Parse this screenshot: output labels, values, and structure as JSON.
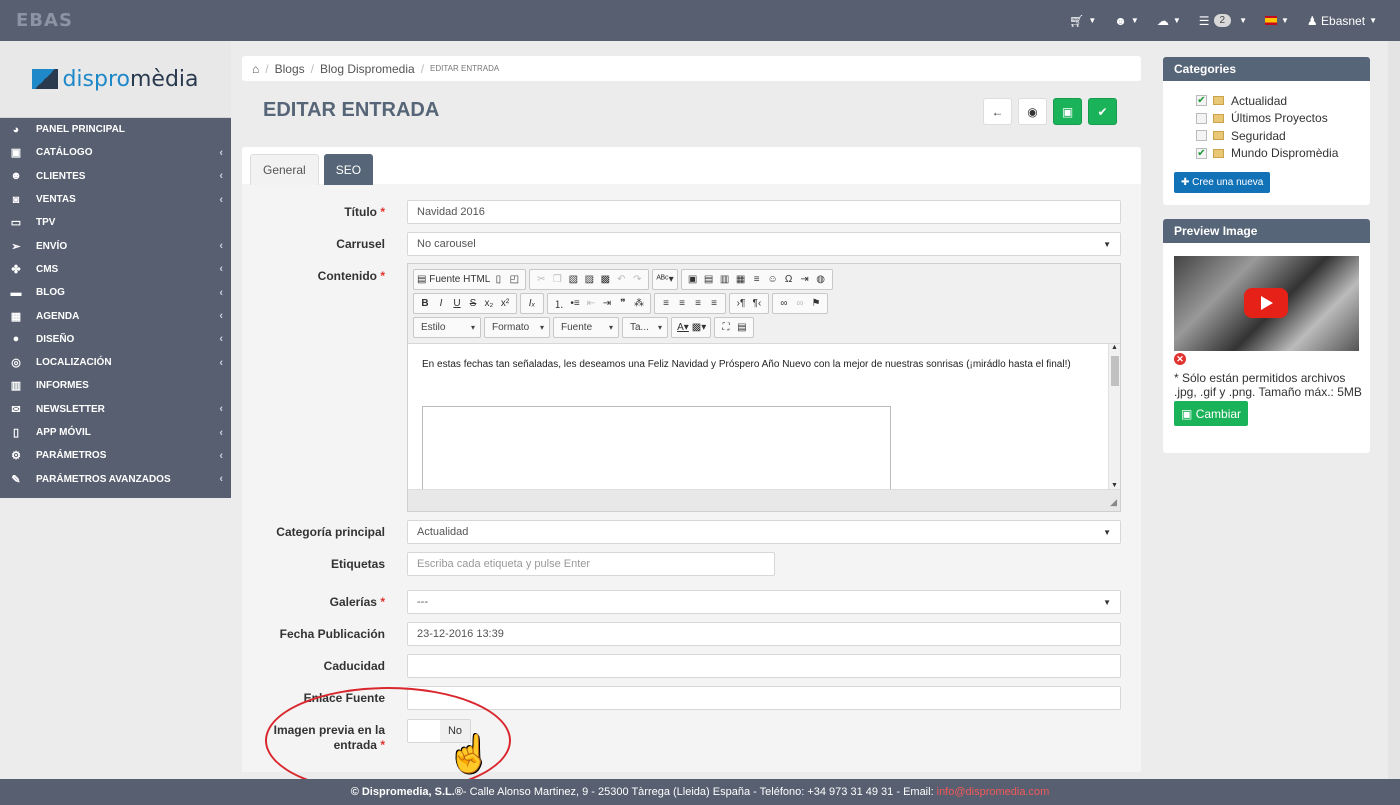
{
  "topbar": {
    "logo": "EBAS",
    "user": "Ebasnet",
    "orders_count": "2"
  },
  "brand": {
    "pre": "dispro",
    "post": "mèdia"
  },
  "menu": [
    {
      "label": "PANEL PRINCIPAL",
      "icon": "dashboard-icon",
      "glyph": "◕",
      "chev": false
    },
    {
      "label": "CATÁLOGO",
      "icon": "catalog-icon",
      "glyph": "▣",
      "chev": true
    },
    {
      "label": "CLIENTES",
      "icon": "users-icon",
      "glyph": "☻",
      "chev": true
    },
    {
      "label": "VENTAS",
      "icon": "sales-icon",
      "glyph": "◙",
      "chev": true
    },
    {
      "label": "TPV",
      "icon": "pos-icon",
      "glyph": "▭",
      "chev": false
    },
    {
      "label": "ENVÍO",
      "icon": "shipping-icon",
      "glyph": "➢",
      "chev": true
    },
    {
      "label": "CMS",
      "icon": "cms-icon",
      "glyph": "✤",
      "chev": true
    },
    {
      "label": "BLOG",
      "icon": "blog-icon",
      "glyph": "▬",
      "chev": true
    },
    {
      "label": "AGENDA",
      "icon": "calendar-icon",
      "glyph": "▦",
      "chev": true
    },
    {
      "label": "DISEÑO",
      "icon": "design-icon",
      "glyph": "●",
      "chev": true
    },
    {
      "label": "LOCALIZACIÓN",
      "icon": "location-icon",
      "glyph": "◎",
      "chev": true
    },
    {
      "label": "INFORMES",
      "icon": "reports-icon",
      "glyph": "▥",
      "chev": false
    },
    {
      "label": "NEWSLETTER",
      "icon": "envelope-icon",
      "glyph": "✉",
      "chev": true
    },
    {
      "label": "APP MÓVIL",
      "icon": "mobile-icon",
      "glyph": "▯",
      "chev": true
    },
    {
      "label": "PARÁMETROS",
      "icon": "settings-icon",
      "glyph": "⚙",
      "chev": true
    },
    {
      "label": "PARÁMETROS AVANZADOS",
      "icon": "wrench-icon",
      "glyph": "✎",
      "chev": true
    }
  ],
  "breadcrumb": {
    "blogs": "Blogs",
    "blog": "Blog Dispromedia",
    "current": "EDITAR ENTRADA"
  },
  "page_title": "EDITAR ENTRADA",
  "tabs": {
    "general": "General",
    "seo": "SEO"
  },
  "form": {
    "titulo_label": "Título",
    "titulo_value": "Navidad 2016",
    "carrusel_label": "Carrusel",
    "carrusel_value": "No carousel",
    "contenido_label": "Contenido",
    "editor_source": "Fuente HTML",
    "editor_estilo": "Estilo",
    "editor_formato": "Formato",
    "editor_fuente": "Fuente",
    "editor_tamano": "Ta...",
    "editor_text": "En estas fechas tan señaladas, les deseamos una Feliz Navidad y Próspero Año Nuevo con la mejor de nuestras sonrisas (¡mirádlo hasta el final!)",
    "categoria_label": "Categoría principal",
    "categoria_value": "Actualidad",
    "etiquetas_label": "Etiquetas",
    "etiquetas_placeholder": "Escriba cada etiqueta y pulse Enter",
    "galerias_label": "Galerías",
    "galerias_value": "---",
    "fecha_label": "Fecha Publicación",
    "fecha_value": "23-12-2016 13:39",
    "caducidad_label": "Caducidad",
    "enlace_label": "Enlace Fuente",
    "imagen_label_1": "Imagen previa en la",
    "imagen_label_2": "entrada",
    "toggle_no": "No"
  },
  "categories": {
    "title": "Categories",
    "items": [
      {
        "label": "Actualidad",
        "checked": true
      },
      {
        "label": "Últimos Proyectos",
        "checked": false
      },
      {
        "label": "Seguridad",
        "checked": false
      },
      {
        "label": "Mundo Dispromèdia",
        "checked": true
      }
    ],
    "new_button": "Cree una nueva"
  },
  "preview": {
    "title": "Preview Image",
    "note": "* Sólo están permitidos archivos .jpg, .gif y .png. Tamaño máx.: 5MB",
    "change_button": "Cambiar"
  },
  "footer": {
    "company": "© Dispromedia, S.L.®",
    "address": " - Calle Alonso Martinez, 9 - 25300 Tàrrega (Lleida) España - Teléfono: +34 973 31 49 31 - Email:",
    "email": "info@dispromedia.com"
  },
  "colors": {
    "topbar": "#575f70",
    "accent_green": "#1bb35a",
    "accent_blue": "#1272b8",
    "required": "#e0322e"
  }
}
